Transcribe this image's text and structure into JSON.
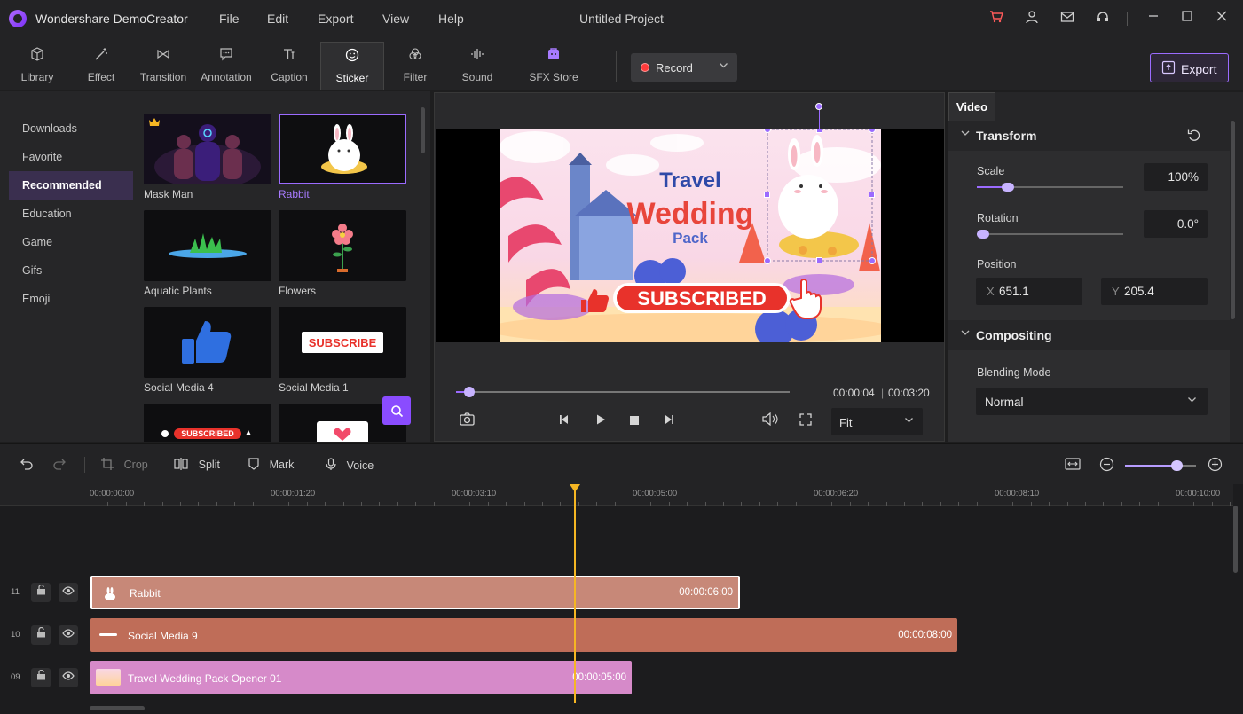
{
  "app": {
    "name": "Wondershare DemoCreator",
    "project_title": "Untitled Project",
    "menu": [
      "File",
      "Edit",
      "Export",
      "View",
      "Help"
    ]
  },
  "titlebar_icons": [
    "cart-icon",
    "user-icon",
    "mail-icon",
    "headset-icon",
    "minimize-icon",
    "maximize-icon",
    "close-icon"
  ],
  "tabs": [
    {
      "label": "Library",
      "icon": "cube-icon"
    },
    {
      "label": "Effect",
      "icon": "magic-wand-icon"
    },
    {
      "label": "Transition",
      "icon": "bowtie-icon"
    },
    {
      "label": "Annotation",
      "icon": "speech-bubble-icon"
    },
    {
      "label": "Caption",
      "icon": "text-icon"
    },
    {
      "label": "Sticker",
      "icon": "smiley-icon"
    },
    {
      "label": "Filter",
      "icon": "circles-icon"
    },
    {
      "label": "Sound",
      "icon": "waveform-icon"
    },
    {
      "label": "SFX Store",
      "icon": "store-icon"
    }
  ],
  "active_tab": "Sticker",
  "record": {
    "label": "Record"
  },
  "export": {
    "label": "Export"
  },
  "sidebar": {
    "items": [
      "Downloads",
      "Favorite",
      "Recommended",
      "Education",
      "Game",
      "Gifs",
      "Emoji"
    ],
    "active": "Recommended"
  },
  "stickers": [
    {
      "label": "Mask Man",
      "premium": true
    },
    {
      "label": "Rabbit",
      "selected": true
    },
    {
      "label": "Aquatic Plants"
    },
    {
      "label": "Flowers"
    },
    {
      "label": "Social Media 4"
    },
    {
      "label": "Social Media 1"
    },
    {
      "label": ""
    },
    {
      "label": ""
    }
  ],
  "sticker_art": {
    "subscribe_text": "SUBSCRIBE",
    "subscribed_text": "SUBSCRIBED"
  },
  "preview": {
    "scene_text": {
      "line1": "Travel",
      "line2": "Wedding",
      "line3": "Pack",
      "button": "SUBSCRIBED"
    },
    "current_time": "00:00:04",
    "total_time": "00:03:20",
    "time_separator": "|",
    "progress": 0.04,
    "fit": "Fit"
  },
  "properties": {
    "tab": "Video",
    "transform": {
      "title": "Transform",
      "scale_label": "Scale",
      "scale_value": "100%",
      "scale_slider": 0.21,
      "rotation_label": "Rotation",
      "rotation_value": "0.0°",
      "rotation_slider": 0.04,
      "position_label": "Position",
      "x_label": "X",
      "x_value": "651.1",
      "y_label": "Y",
      "y_value": "205.4"
    },
    "compositing": {
      "title": "Compositing",
      "blend_label": "Blending Mode",
      "blend_value": "Normal"
    }
  },
  "timeline_toolbar": {
    "crop": "Crop",
    "split": "Split",
    "mark": "Mark",
    "voice": "Voice",
    "zoom": 0.72
  },
  "ruler": [
    "00:00:00:00",
    "00:00:01:20",
    "00:00:03:10",
    "00:00:05:00",
    "00:00:06:20",
    "00:00:08:10",
    "00:00:10:00"
  ],
  "tracks": [
    {
      "number": "11",
      "clip": "Rabbit",
      "duration": "00:00:06:00"
    },
    {
      "number": "10",
      "clip": "Social Media 9",
      "duration": "00:00:08:00"
    },
    {
      "number": "09",
      "clip": "Travel Wedding Pack Opener 01",
      "duration": "00:00:05:00"
    }
  ],
  "colors": {
    "accent": "#9b6bff",
    "playhead": "#f5b623",
    "clip_rabbit": "#c78878",
    "clip_social": "#bf6d58",
    "clip_travel": "#d68ac9"
  }
}
